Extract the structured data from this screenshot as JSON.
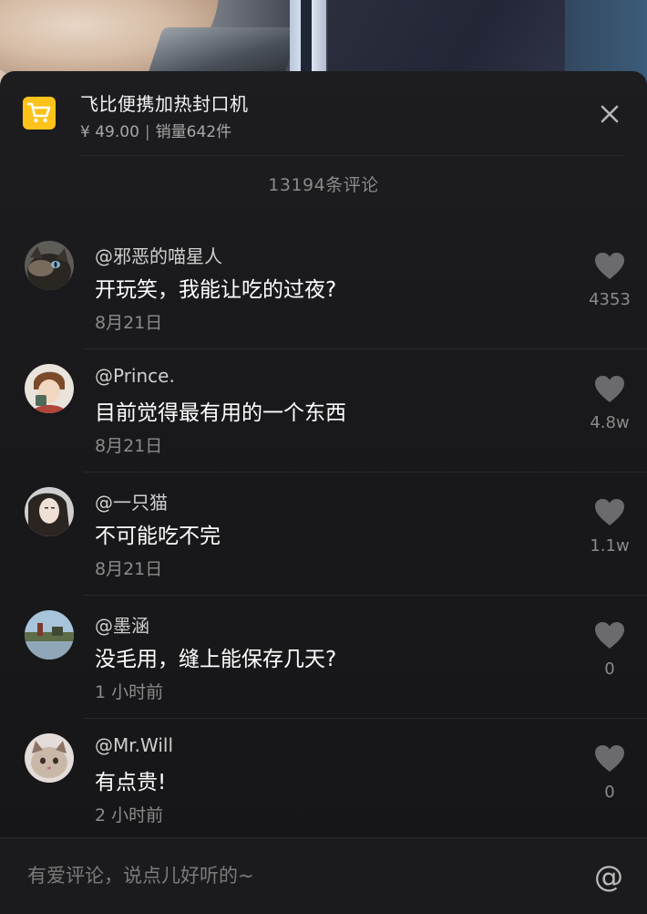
{
  "product": {
    "title": "飞比便携加热封口机",
    "price": "¥ 49.00",
    "separator": "|",
    "sales": "销量642件",
    "icon": "shopping-cart-icon",
    "accent": "#ffc21a"
  },
  "close_icon": "close-icon",
  "comment_count": "13194条评论",
  "comments": [
    {
      "username": "@邪恶的喵星人",
      "text": "开玩笑，我能让吃的过夜?",
      "time": "8月21日",
      "likes": "4353"
    },
    {
      "username": "@Prince.",
      "text": "目前觉得最有用的一个东西",
      "time": "8月21日",
      "likes": "4.8w"
    },
    {
      "username": "@一只猫",
      "text": "不可能吃不完",
      "time": "8月21日",
      "likes": "1.1w"
    },
    {
      "username": "@墨涵",
      "text": "没毛用，缝上能保存几天?",
      "time": "1 小时前",
      "likes": "0"
    },
    {
      "username": "@Mr.Will",
      "text": "有点贵!",
      "time": "2 小时前",
      "likes": "0"
    }
  ],
  "input": {
    "placeholder": "有爱评论，说点儿好听的~",
    "value": "",
    "at_label": "@"
  }
}
